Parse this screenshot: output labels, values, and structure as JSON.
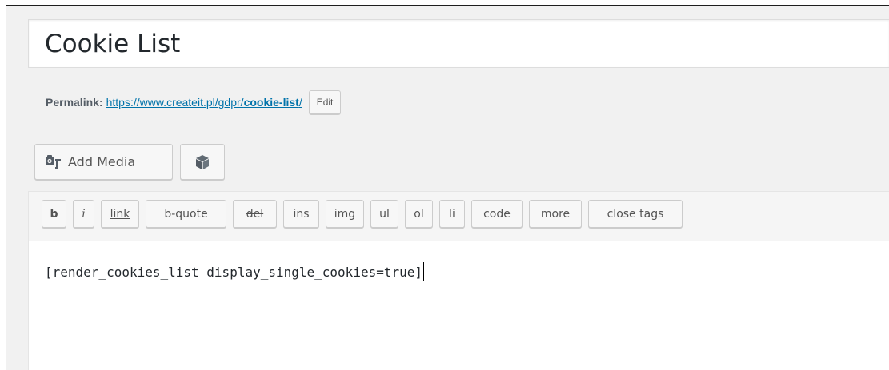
{
  "post": {
    "title": "Cookie List"
  },
  "permalink": {
    "label": "Permalink:",
    "url_base": "https://www.createit.pl/gdpr/",
    "url_slug": "cookie-list",
    "url_trailing": "/",
    "edit_label": "Edit"
  },
  "media_buttons": {
    "add_media_label": "Add Media",
    "add_media_icon": "media-camera-icon",
    "block_icon": "cube-icon"
  },
  "quicktags": [
    {
      "label": "b"
    },
    {
      "label": "i"
    },
    {
      "label": "link"
    },
    {
      "label": "b-quote"
    },
    {
      "label": "del"
    },
    {
      "label": "ins"
    },
    {
      "label": "img"
    },
    {
      "label": "ul"
    },
    {
      "label": "ol"
    },
    {
      "label": "li"
    },
    {
      "label": "code"
    },
    {
      "label": "more"
    },
    {
      "label": "close tags"
    }
  ],
  "editor": {
    "content": "[render_cookies_list display_single_cookies=true]"
  },
  "colors": {
    "link": "#0073aa",
    "text": "#23282d",
    "button_bg": "#f7f7f7",
    "border": "#cccccc",
    "background": "#f1f1f1"
  }
}
